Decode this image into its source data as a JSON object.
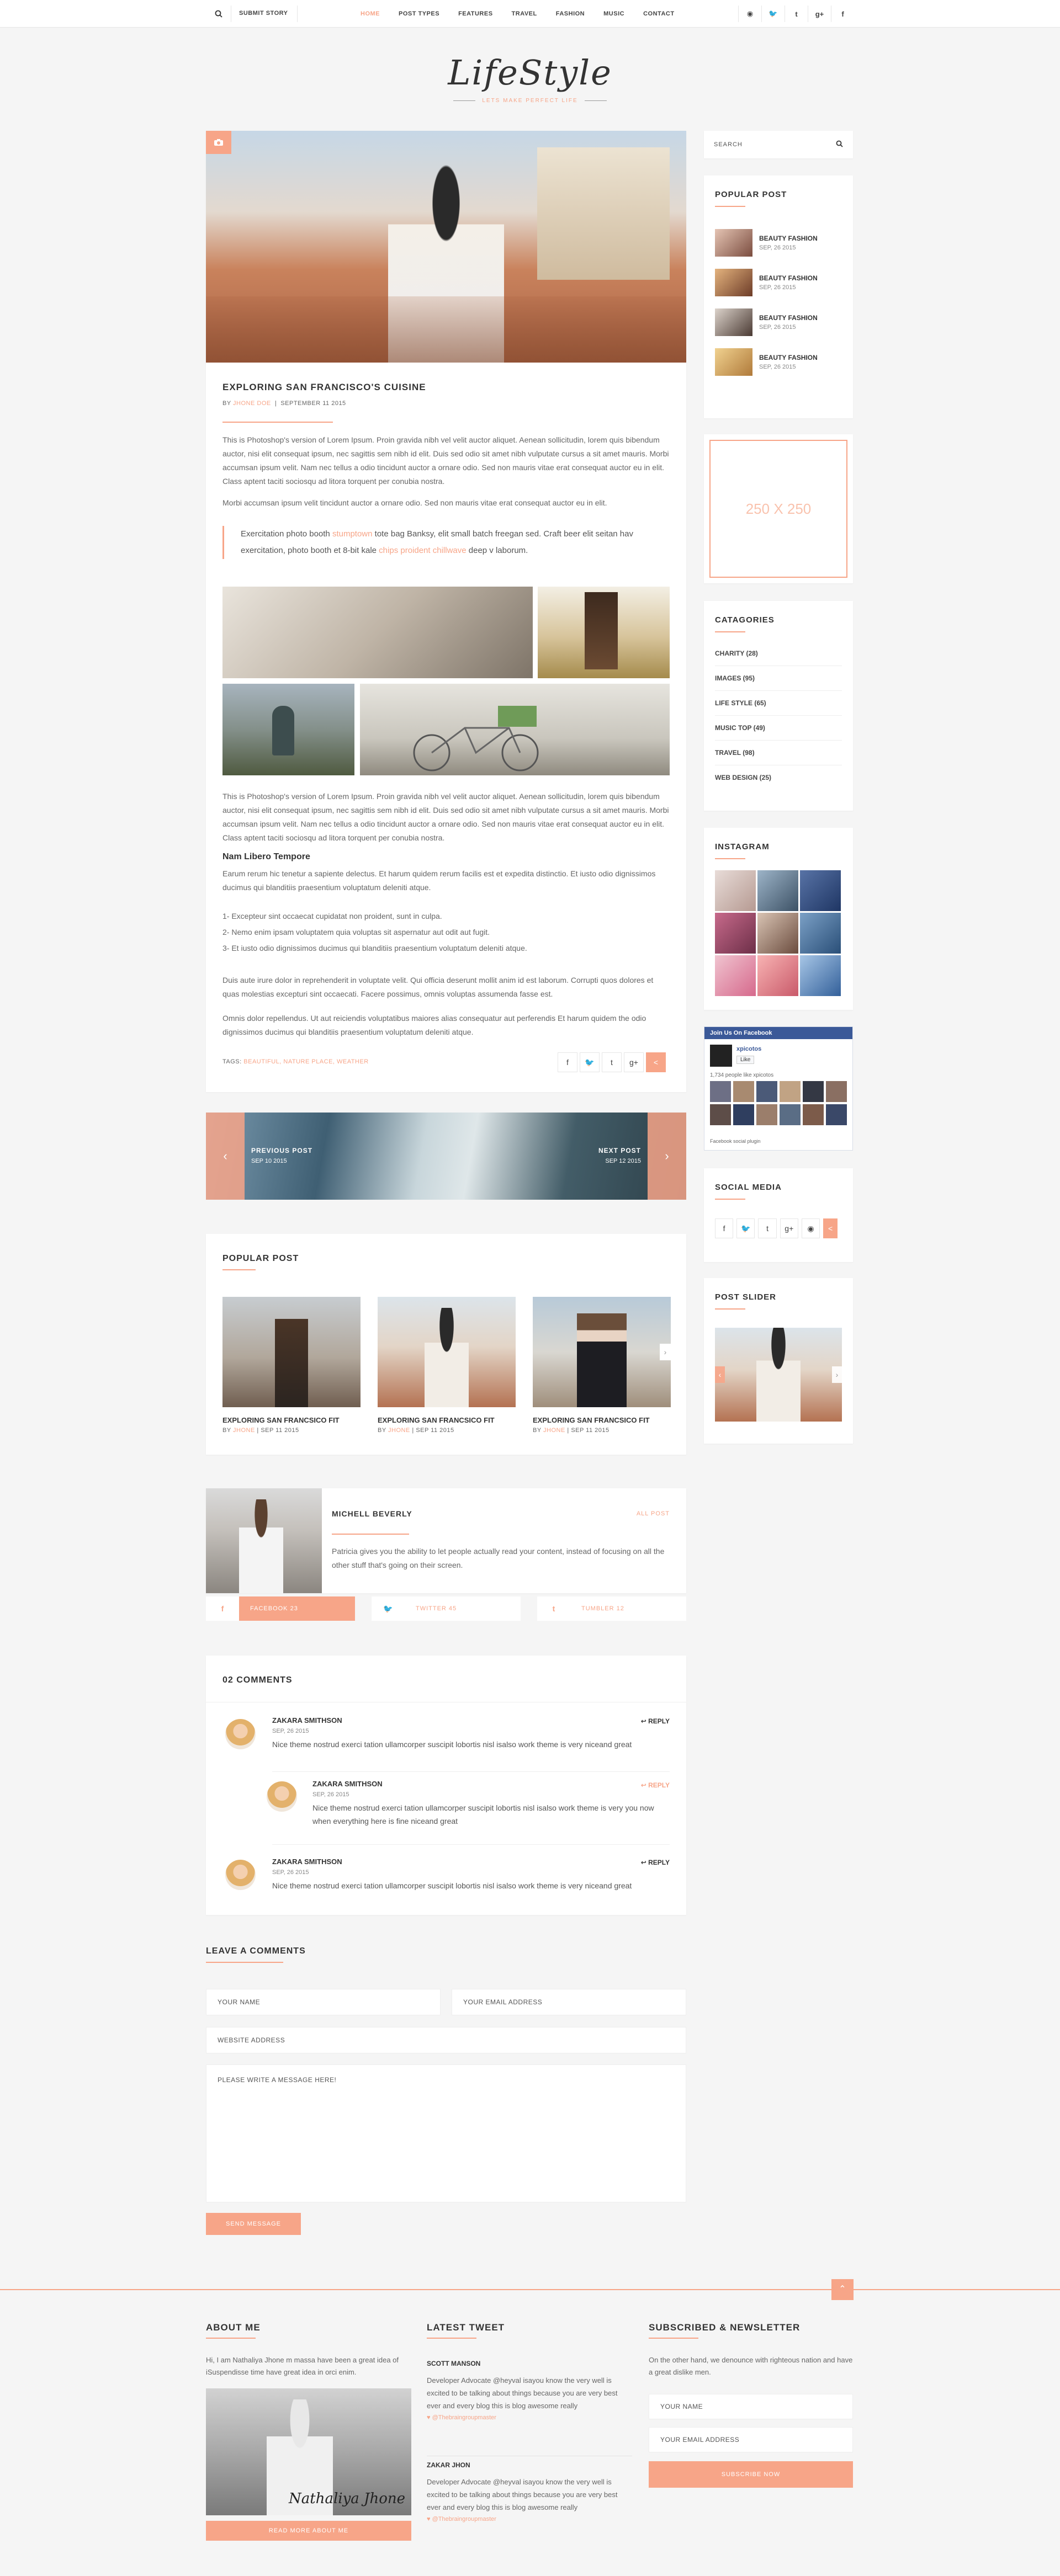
{
  "topbar": {
    "submit": "SUBMIT STORY",
    "nav": [
      "HOME",
      "POST TYPES",
      "FEATURES",
      "TRAVEL",
      "FASHION",
      "MUSIC",
      "CONTACT"
    ],
    "social": [
      "rss-icon",
      "twitter-icon",
      "tumblr-icon",
      "googleplus-icon",
      "facebook-icon"
    ]
  },
  "logo": {
    "title": "LifeStyle",
    "tagline": "LETS MAKE PERFECT LIFE"
  },
  "post": {
    "title": "EXPLORING SAN FRANCISCO'S CUISINE",
    "by": "BY",
    "author": "JHONE DOE",
    "date": "SEPTEMBER 11 2015",
    "p1": "This is Photoshop's version of Lorem Ipsum. Proin gravida nibh vel velit auctor aliquet. Aenean sollicitudin, lorem quis bibendum auctor, nisi elit consequat ipsum, nec sagittis sem nibh id elit. Duis sed odio sit amet nibh vulputate cursus a sit amet mauris. Morbi accumsan ipsum velit. Nam nec tellus a odio tincidunt auctor a ornare odio. Sed non mauris vitae erat consequat auctor eu in elit. Class aptent taciti sociosqu ad litora torquent per conubia nostra.",
    "p2": "Morbi accumsan ipsum velit tincidunt auctor a ornare odio. Sed non mauris vitae erat consequat auctor eu in elit.",
    "quote_a": "Exercitation photo booth ",
    "quote_link1": "stumptown",
    "quote_b": " tote bag Banksy, elit small batch freegan sed. Craft beer elit seitan hav exercitation, photo booth et 8-bit kale ",
    "quote_link2": "chips proident chillwave",
    "quote_c": " deep v laborum.",
    "p3": "This is Photoshop's version of Lorem Ipsum. Proin gravida nibh vel velit auctor aliquet. Aenean sollicitudin, lorem quis bibendum auctor, nisi elit consequat ipsum, nec sagittis sem nibh id elit. Duis sed odio sit amet nibh vulputate cursus a sit amet mauris. Morbi accumsan ipsum velit. Nam nec tellus a odio tincidunt auctor a ornare odio. Sed non mauris vitae erat consequat auctor eu in elit. Class aptent taciti sociosqu ad litora torquent per conubia nostra.",
    "subhead": "Nam Libero Tempore",
    "p4": "Earum rerum hic tenetur a sapiente delectus. Et harum quidem rerum facilis est et expedita distinctio. Et iusto odio dignissimos ducimus qui blanditiis praesentium voluptatum deleniti atque.",
    "list": [
      "1- Excepteur sint occaecat cupidatat non proident, sunt in culpa.",
      "2- Nemo enim ipsam voluptatem quia voluptas sit aspernatur aut odit aut fugit.",
      "3- Et iusto odio dignissimos ducimus qui blanditiis praesentium voluptatum deleniti atque."
    ],
    "p5": "Duis aute irure dolor in reprehenderit in voluptate velit. Qui officia deserunt mollit anim id est laborum. Corrupti quos dolores et quas molestias excepturi sint occaecati. Facere possimus, omnis voluptas assumenda fasse est.",
    "p6": "Omnis dolor repellendus. Ut aut reiciendis voluptatibus maiores alias consequatur aut perferendis Et harum quidem the odio dignissimos ducimus qui blanditiis praesentium voluptatum deleniti atque.",
    "tags_label": "TAGS:",
    "tags": "BEAUTIFUL, NATURE PLACE, WEATHER"
  },
  "prevnext": {
    "prev": "PREVIOUS POST",
    "prev_date": "SEP 10 2015",
    "next": "NEXT POST",
    "next_date": "SEP 12 2015"
  },
  "popular": {
    "title": "POPULAR POST",
    "items": [
      {
        "t": "EXPLORING SAN FRANCSICO FIT",
        "by": "BY",
        "a": "JHONE",
        "d": "SEP 11 2015"
      },
      {
        "t": "EXPLORING SAN FRANCSICO FIT",
        "by": "BY",
        "a": "JHONE",
        "d": "SEP 11 2015"
      },
      {
        "t": "EXPLORING SAN FRANCSICO FIT",
        "by": "BY",
        "a": "JHONE",
        "d": "SEP 11 2015"
      }
    ]
  },
  "author": {
    "name": "MICHELL BEVERLY",
    "all": "ALL POST",
    "bio": "Patricia gives you the ability to let people actually read your content, instead of focusing on all the other stuff that's going on their screen.",
    "facebook": "FACEBOOK 23",
    "twitter": "TWITTER 45",
    "tumblr": "TUMBLER 12"
  },
  "comments": {
    "title": "02 COMMENTS",
    "reply": "REPLY",
    "items": [
      {
        "n": "ZAKARA SMITHSON",
        "d": "SEP, 26 2015",
        "b": "Nice theme nostrud exerci tation ullamcorper suscipit lobortis nisl isalso work theme is very niceand great"
      },
      {
        "n": "ZAKARA SMITHSON",
        "d": "SEP, 26 2015",
        "b": "Nice theme nostrud exerci tation ullamcorper suscipit lobortis nisl isalso work theme is very you now when everything here is fine niceand great"
      },
      {
        "n": "ZAKARA SMITHSON",
        "d": "SEP, 26 2015",
        "b": "Nice theme nostrud exerci tation ullamcorper suscipit lobortis nisl isalso work theme is very niceand great"
      }
    ]
  },
  "leave": {
    "title": "LEAVE A COMMENTS",
    "name": "YOUR NAME",
    "email": "YOUR EMAIL ADDRESS",
    "website": "WEBSITE ADDRESS",
    "message": "PLEASE WRITE A MESSAGE HERE!",
    "send": "SEND MESSAGE"
  },
  "sidebar": {
    "search": "SEARCH",
    "popular_title": "POPULAR POST",
    "popular": [
      {
        "t": "BEAUTY FASHION",
        "d": "SEP, 26 2015"
      },
      {
        "t": "BEAUTY FASHION",
        "d": "SEP, 26 2015"
      },
      {
        "t": "BEAUTY FASHION",
        "d": "SEP, 26 2015"
      },
      {
        "t": "BEAUTY FASHION",
        "d": "SEP, 26 2015"
      }
    ],
    "ad": "250 X 250",
    "categories_title": "CATAGORIES",
    "categories": [
      "CHARITY (28)",
      "IMAGES (95)",
      "LIFE STYLE (65)",
      "MUSIC TOP (49)",
      "TRAVEL (98)",
      "WEB DESIGN (25)"
    ],
    "instagram": "INSTAGRAM",
    "fb_title": "Join Us On Facebook",
    "fb_name": "xpicotos",
    "fb_like": "Like",
    "fb_count": "1,734 people like xpicotos",
    "fb_plugin": "Facebook social plugin",
    "social": "SOCIAL MEDIA",
    "slider": "POST SLIDER"
  },
  "footer": {
    "about_title": "ABOUT ME",
    "about": "Hi, I am Nathaliya Jhone m massa have been a great idea of iSuspendisse time have great idea in orci enim.",
    "signature": "Nathaliya Jhone",
    "read_more": "READ MORE ABOUT ME",
    "tweet_title": "LATEST TWEET",
    "tweets": [
      {
        "n": "SCOTT MANSON",
        "b": "Developer Advocate @heyval isayou know the very well is excited to be talking about things because you are very best ever and every blog this is blog awesome really",
        "h": "@Thebraingroupmaster"
      },
      {
        "n": "ZAKAR JHON",
        "b": "Developer Advocate @heyval isayou know the very well is excited to be talking about things because you are very best ever and every blog this is blog awesome really",
        "h": "@Thebraingroupmaster"
      }
    ],
    "news_title": "SUBSCRIBED & NEWSLETTER",
    "news": "On the other hand, we denounce with righteous nation and have a great dislike men.",
    "name": "YOUR NAME",
    "email": "YOUR EMAIL ADDRESS",
    "subscribe": "SUBSCRIBE NOW"
  }
}
